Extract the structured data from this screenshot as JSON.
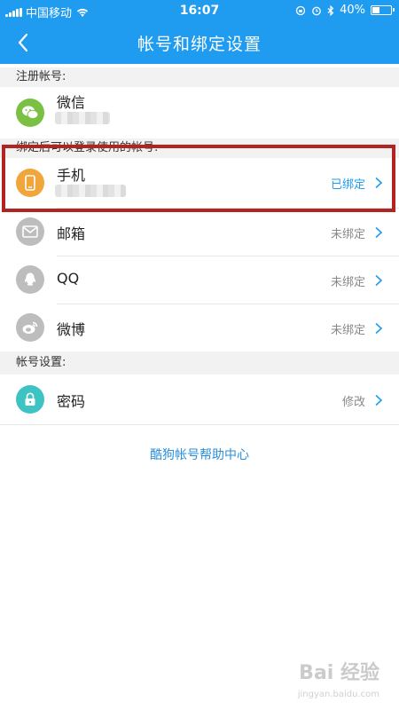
{
  "status_bar": {
    "carrier": "中国移动",
    "time": "16:07",
    "battery": "40%",
    "battery_level": 0.4
  },
  "nav": {
    "title": "帐号和绑定设置"
  },
  "sections": {
    "registered": "注册帐号:",
    "bind": "绑定后可以登录使用的帐号:",
    "account": "帐号设置:"
  },
  "rows": {
    "wechat": {
      "label": "微信"
    },
    "phone": {
      "label": "手机",
      "status": "已绑定"
    },
    "email": {
      "label": "邮箱",
      "status": "未绑定"
    },
    "qq": {
      "label": "QQ",
      "status": "未绑定"
    },
    "weibo": {
      "label": "微博",
      "status": "未绑定"
    },
    "password": {
      "label": "密码",
      "status": "修改"
    }
  },
  "help_link": "酷狗帐号帮助中心",
  "watermark": {
    "brand": "Bai 经验",
    "url": "jingyan.baidu.com"
  },
  "colors": {
    "primary": "#1f9bf0",
    "wechat": "#7ac143",
    "phone": "#f0a63a",
    "inactive_icon": "#bdbdbd",
    "password": "#3ec3c3",
    "highlight": "#b3231f"
  }
}
